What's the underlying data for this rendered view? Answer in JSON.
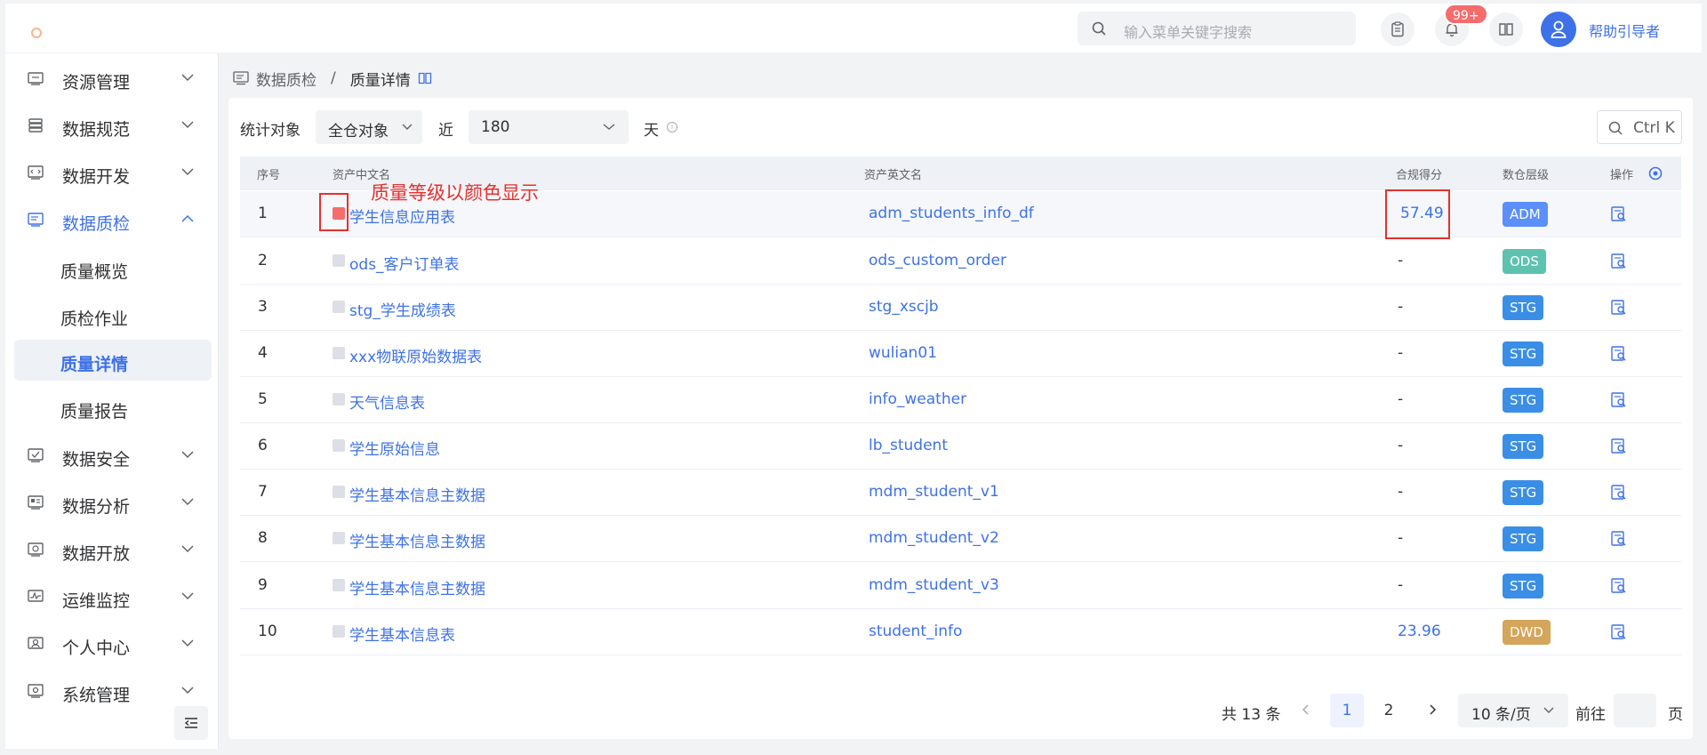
{
  "header": {
    "search_placeholder": "输入菜单关键字搜索",
    "notification_count": "99+",
    "username": "帮助引导者",
    "icons": [
      "search-icon",
      "clipboard-icon",
      "bell-icon",
      "book-icon",
      "user-icon"
    ]
  },
  "sidebar": {
    "items": [
      {
        "label": "资源管理",
        "icon": "server-icon"
      },
      {
        "label": "数据规范",
        "icon": "database-icon"
      },
      {
        "label": "数据开发",
        "icon": "code-icon"
      },
      {
        "label": "数据质检",
        "icon": "monitor-icon"
      },
      {
        "label": "数据安全",
        "icon": "shield-check-icon"
      },
      {
        "label": "数据分析",
        "icon": "chart-icon"
      },
      {
        "label": "数据开放",
        "icon": "share-icon"
      },
      {
        "label": "运维监控",
        "icon": "pulse-icon"
      },
      {
        "label": "个人中心",
        "icon": "person-icon"
      },
      {
        "label": "系统管理",
        "icon": "settings-icon"
      }
    ],
    "sub_items": [
      "质量概览",
      "质检作业",
      "质量详情",
      "质量报告"
    ]
  },
  "breadcrumb": {
    "parent": "数据质检",
    "current": "质量详情"
  },
  "filters": {
    "object_label": "统计对象",
    "object_value": "全仓对象",
    "near_label": "近",
    "days_value": "180",
    "days_unit": "天",
    "shortcut": "Ctrl K"
  },
  "table": {
    "headers": {
      "index": "序号",
      "cn_name": "资产中文名",
      "en_name": "资产英文名",
      "score": "合规得分",
      "layer": "数仓层级",
      "ops": "操作"
    },
    "rows": [
      {
        "index": "1",
        "cn": "学生信息应用表",
        "en": "adm_students_info_df",
        "score": "57.49",
        "layer": "ADM",
        "color": "#5b8ff9",
        "grade": "red"
      },
      {
        "index": "2",
        "cn": "ods_客户订单表",
        "en": "ods_custom_order",
        "score": "-",
        "layer": "ODS",
        "color": "#5ec2b0",
        "grade": "gray"
      },
      {
        "index": "3",
        "cn": "stg_学生成绩表",
        "en": "stg_xscjb",
        "score": "-",
        "layer": "STG",
        "color": "#3a8ee6",
        "grade": "gray"
      },
      {
        "index": "4",
        "cn": "xxx物联原始数据表",
        "en": "wulian01",
        "score": "-",
        "layer": "STG",
        "color": "#3a8ee6",
        "grade": "gray"
      },
      {
        "index": "5",
        "cn": "天气信息表",
        "en": "info_weather",
        "score": "-",
        "layer": "STG",
        "color": "#3a8ee6",
        "grade": "gray"
      },
      {
        "index": "6",
        "cn": "学生原始信息",
        "en": "lb_student",
        "score": "-",
        "layer": "STG",
        "color": "#3a8ee6",
        "grade": "gray"
      },
      {
        "index": "7",
        "cn": "学生基本信息主数据",
        "en": "mdm_student_v1",
        "score": "-",
        "layer": "STG",
        "color": "#3a8ee6",
        "grade": "gray"
      },
      {
        "index": "8",
        "cn": "学生基本信息主数据",
        "en": "mdm_student_v2",
        "score": "-",
        "layer": "STG",
        "color": "#3a8ee6",
        "grade": "gray"
      },
      {
        "index": "9",
        "cn": "学生基本信息主数据",
        "en": "mdm_student_v3",
        "score": "-",
        "layer": "STG",
        "color": "#3a8ee6",
        "grade": "gray"
      },
      {
        "index": "10",
        "cn": "学生基本信息表",
        "en": "student_info",
        "score": "23.96",
        "layer": "DWD",
        "color": "#d4a55a",
        "grade": "gray"
      }
    ]
  },
  "annotation": "质量等级以颜色显示",
  "pagination": {
    "total": "共 13 条",
    "pages": [
      "1",
      "2"
    ],
    "page_size": "10 条/页",
    "goto_prefix": "前往",
    "goto_suffix": "页"
  }
}
